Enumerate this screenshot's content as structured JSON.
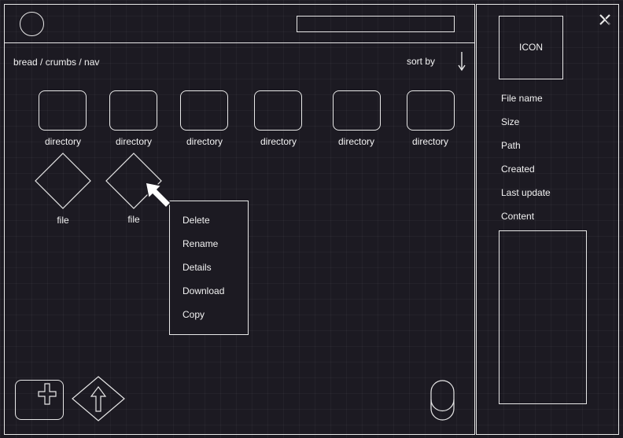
{
  "header": {
    "search_value": ""
  },
  "toolbar": {
    "breadcrumb": "bread / crumbs / nav",
    "sort_label": "sort by"
  },
  "directories": [
    {
      "label": "directory"
    },
    {
      "label": "directory"
    },
    {
      "label": "directory"
    },
    {
      "label": "directory"
    },
    {
      "label": "directory"
    },
    {
      "label": "directory"
    }
  ],
  "files": [
    {
      "label": "file"
    },
    {
      "label": "file"
    }
  ],
  "context_menu": {
    "items": [
      "Delete",
      "Rename",
      "Details",
      "Download",
      "Copy"
    ]
  },
  "details_panel": {
    "icon_label": "ICON",
    "properties": [
      "File name",
      "Size",
      "Path",
      "Created",
      "Last update",
      "Content"
    ]
  },
  "icons": {
    "close": "close-icon",
    "add": "plus-icon",
    "upload": "upload-arrow-icon",
    "sort": "arrow-down-icon",
    "avatar": "avatar-circle"
  },
  "colors": {
    "background": "#1c1a22",
    "stroke": "#e8e8e8",
    "text": "#f2f2f2"
  }
}
